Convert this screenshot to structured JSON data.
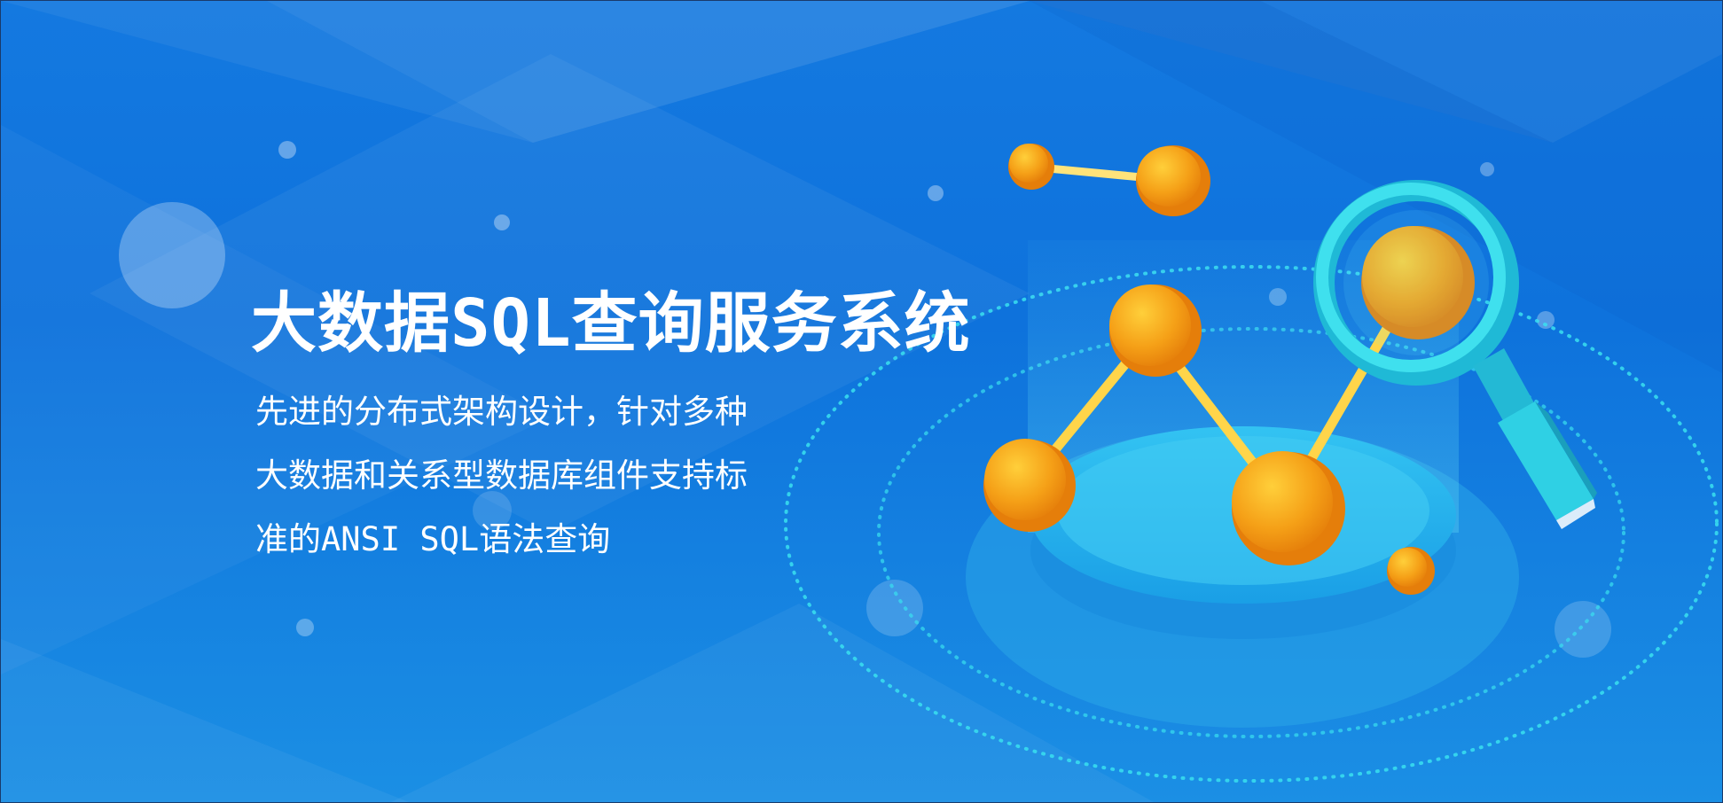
{
  "hero": {
    "title": "大数据SQL查询服务系统",
    "description_lines": [
      "先进的分布式架构设计，针对多种",
      "大数据和关系型数据库组件支持标",
      "准的ANSI SQL语法查询"
    ]
  },
  "colors": {
    "background_top": "#1479e0",
    "background_bottom": "#1b8fe4",
    "node_orange": "#f7a21b",
    "node_highlight": "#ffd84a",
    "platform_cyan": "#2ab8ee",
    "magnifier_cyan": "#2fd6e6",
    "dotted_ring": "#39e0f0"
  },
  "illustration": {
    "icons": [
      "magnifier-icon",
      "data-node-icon",
      "platform-disc"
    ]
  }
}
